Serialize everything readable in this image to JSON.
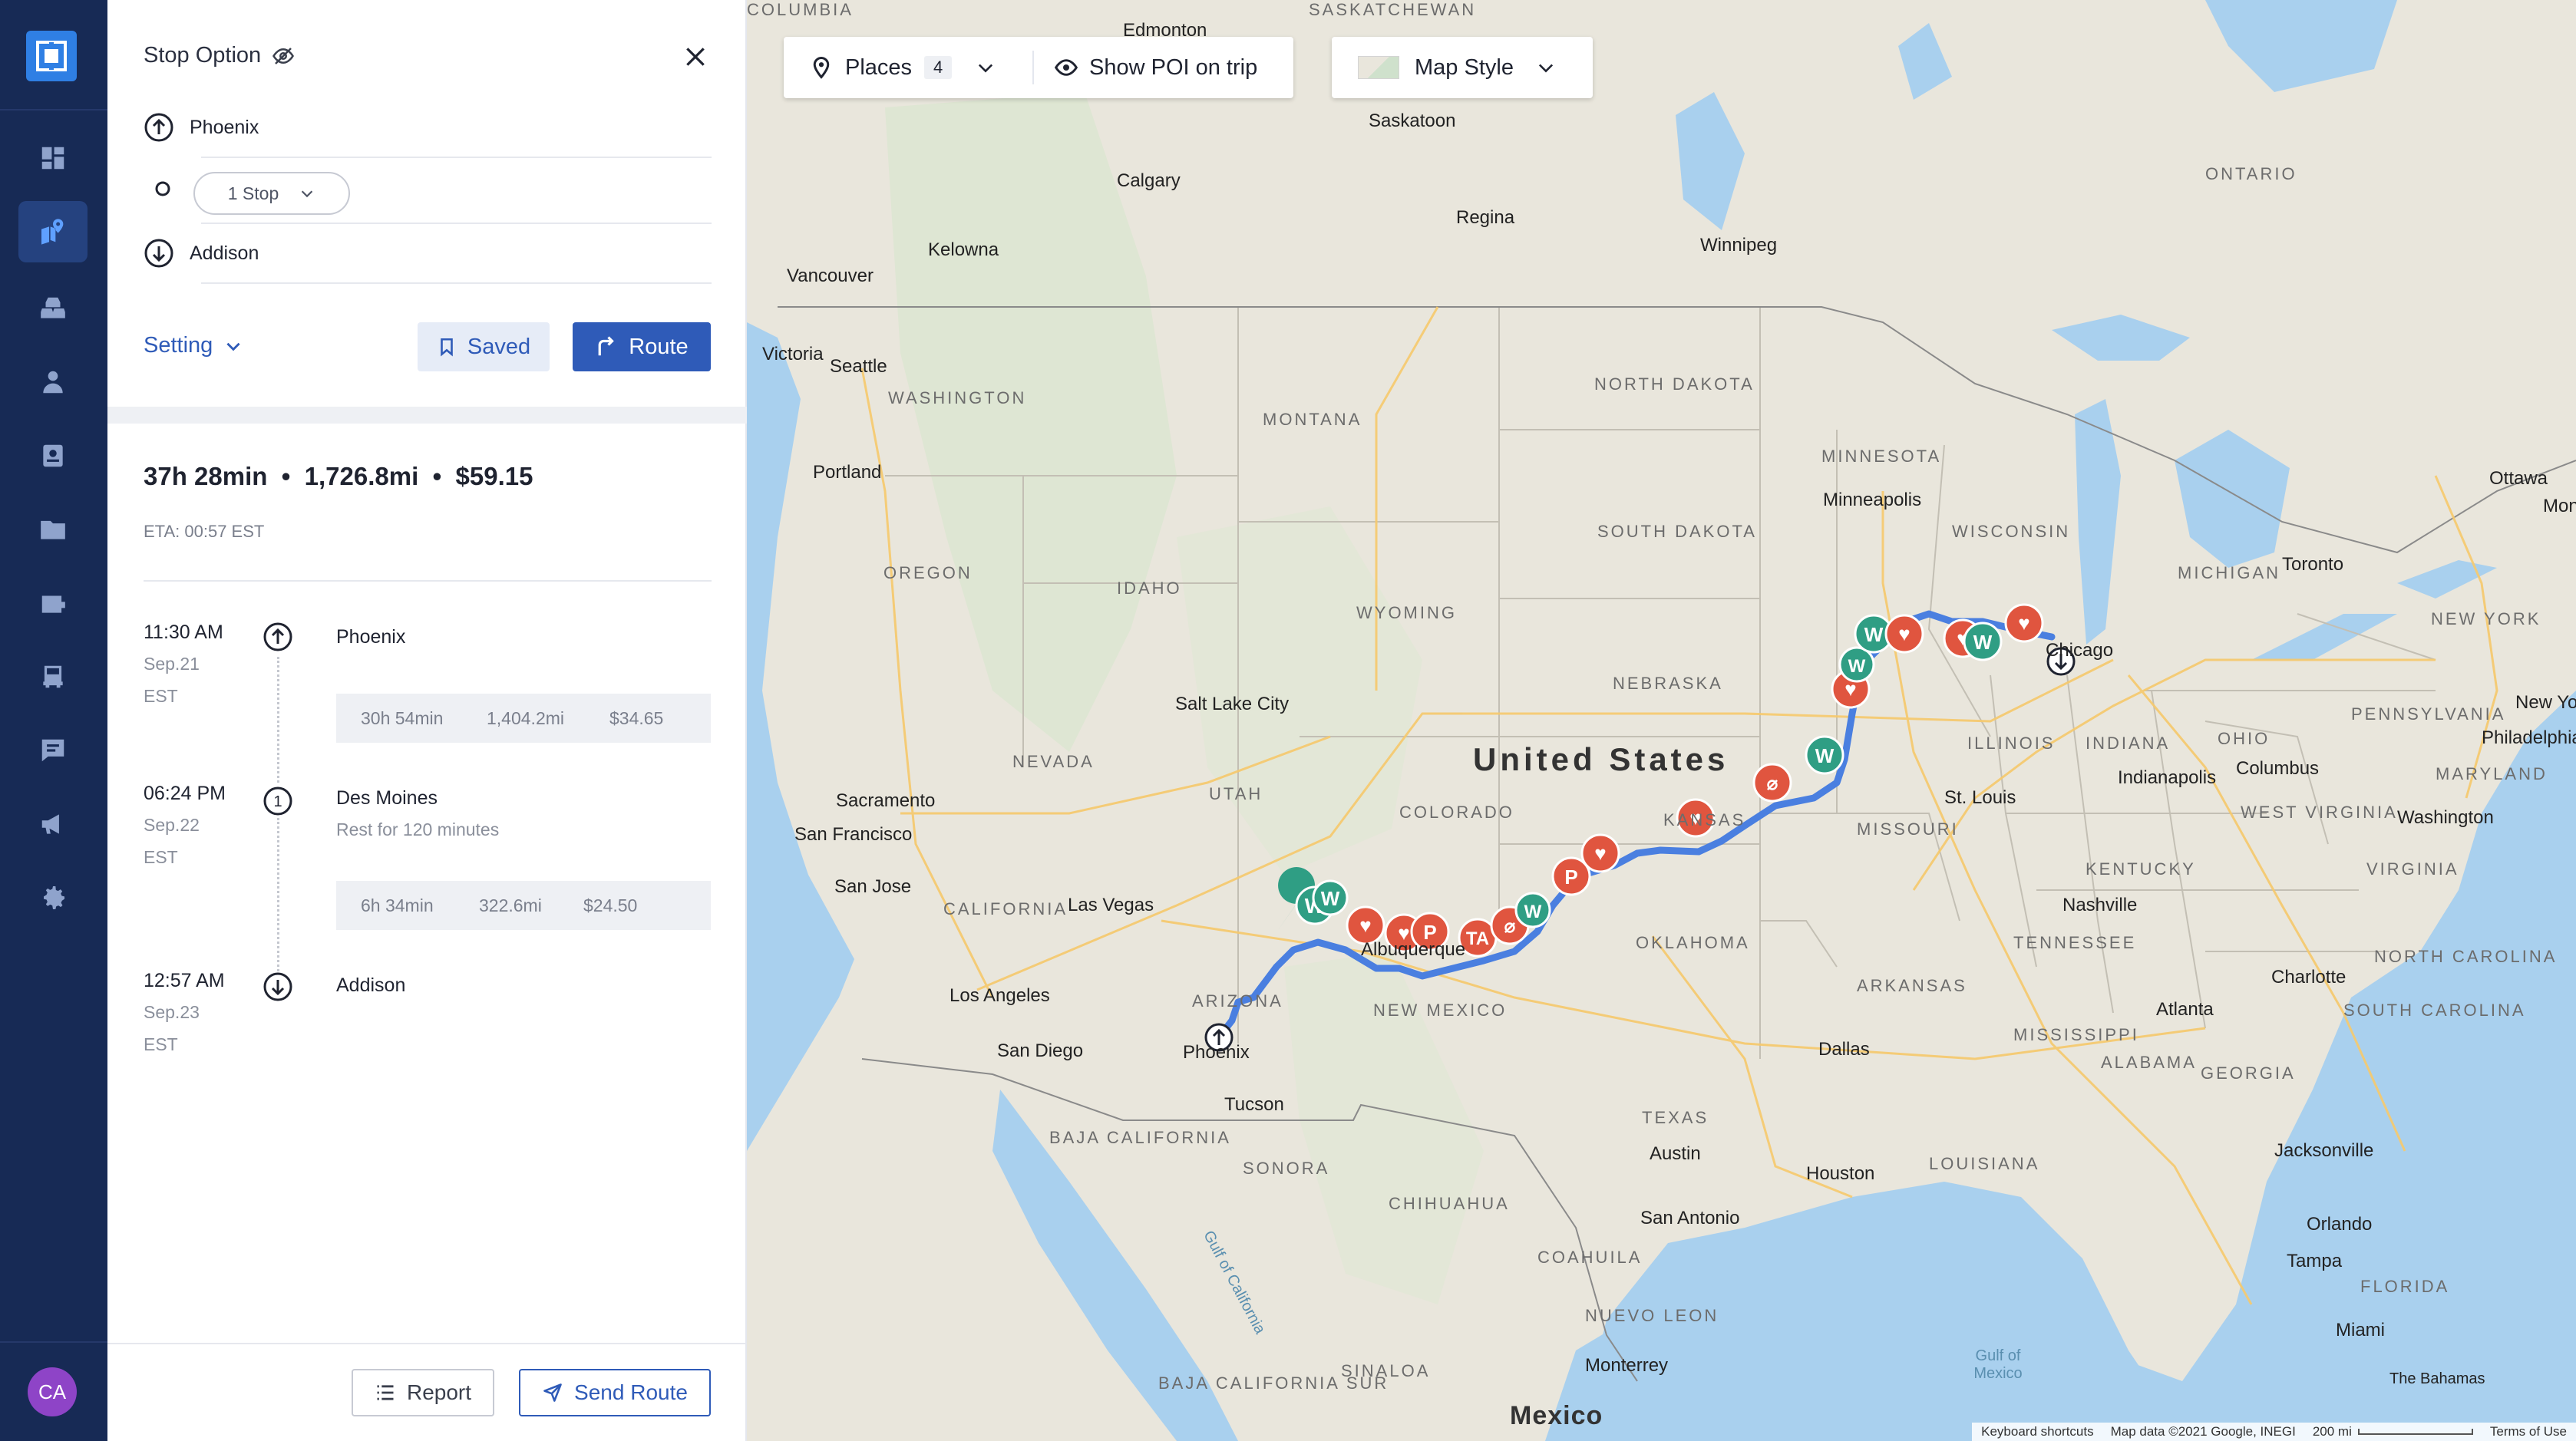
{
  "nav": {
    "items": [
      "dashboard-icon",
      "route-planner-icon",
      "fleet-icon",
      "driver-icon",
      "contacts-icon",
      "folder-icon",
      "wallet-icon",
      "truck-icon",
      "messages-icon",
      "broadcast-icon",
      "settings-icon"
    ],
    "avatar": "CA",
    "accent": "#2f7fe4",
    "bg": "#172a55"
  },
  "panel": {
    "title": "Stop Option",
    "origin": "Phoenix",
    "stops_select": "1 Stop",
    "destination": "Addison",
    "setting_label": "Setting",
    "saved_label": "Saved",
    "route_label": "Route",
    "summary": {
      "duration": "37h 28min",
      "distance": "1,726.8mi",
      "cost": "$59.15",
      "eta": "ETA: 00:57 EST"
    },
    "timeline": [
      {
        "time": "11:30 AM",
        "date": "Sep.21",
        "tz": "EST",
        "name": "Phoenix",
        "note": "",
        "leg": {
          "duration": "30h 54min",
          "distance": "1,404.2mi",
          "cost": "$34.65"
        }
      },
      {
        "time": "06:24 PM",
        "date": "Sep.22",
        "tz": "EST",
        "name": "Des Moines",
        "note": "Rest for 120 minutes",
        "leg": {
          "duration": "6h 34min",
          "distance": "322.6mi",
          "cost": "$24.50"
        }
      },
      {
        "time": "12:57 AM",
        "date": "Sep.23",
        "tz": "EST",
        "name": "Addison",
        "note": ""
      }
    ],
    "report_label": "Report",
    "send_label": "Send Route",
    "primary_color": "#2f5bb8"
  },
  "map": {
    "places_label": "Places",
    "places_count": "4",
    "poi_label": "Show POI on trip",
    "style_label": "Map Style",
    "country": "United States",
    "country2": "Mexico",
    "states": [
      "WASHINGTON",
      "OREGON",
      "CALIFORNIA",
      "NEVADA",
      "IDAHO",
      "MONTANA",
      "WYOMING",
      "UTAH",
      "ARIZONA",
      "COLORADO",
      "NEW MEXICO",
      "NORTH DAKOTA",
      "SOUTH DAKOTA",
      "NEBRASKA",
      "KANSAS",
      "OKLAHOMA",
      "TEXAS",
      "MINNESOTA",
      "WISCONSIN",
      "ILLINOIS",
      "MISSOURI",
      "ARKANSAS",
      "LOUISIANA",
      "MISSISSIPPI",
      "ALABAMA",
      "GEORGIA",
      "TENNESSEE",
      "KENTUCKY",
      "INDIANA",
      "OHIO",
      "MICHIGAN",
      "PENNSYLVANIA",
      "NEW YORK",
      "WEST VIRGINIA",
      "VIRGINIA",
      "NORTH CAROLINA",
      "SOUTH CAROLINA",
      "FLORIDA",
      "MARYLAND",
      "ONTARIO",
      "BAJA CALIFORNIA",
      "BAJA CALIFORNIA SUR",
      "SONORA",
      "CHIHUAHUA",
      "COAHUILA",
      "NUEVO LEON",
      "SINALOA",
      "SASKATCHEWAN",
      "COLUMBIA"
    ],
    "cities": [
      "Edmonton",
      "Calgary",
      "Saskatoon",
      "Regina",
      "Winnipeg",
      "Vancouver",
      "Victoria",
      "Seattle",
      "Kelowna",
      "Portland",
      "Sacramento",
      "San Francisco",
      "San Jose",
      "Las Vegas",
      "Los Angeles",
      "San Diego",
      "Phoenix",
      "Tucson",
      "Salt Lake City",
      "Minneapolis",
      "Chicago",
      "Indianapolis",
      "Columbus",
      "St. Louis",
      "Nashville",
      "Atlanta",
      "Charlotte",
      "Dallas",
      "Austin",
      "Houston",
      "San Antonio",
      "Monterrey",
      "Jacksonville",
      "Orlando",
      "Tampa",
      "Miami",
      "Toronto",
      "Ottawa",
      "Montr",
      "New York",
      "Philadelphia",
      "Washington",
      "Albuquerque",
      "The Bahamas"
    ],
    "water": [
      "Gulf of California",
      "Gulf of Mexico"
    ],
    "attribution": {
      "shortcuts": "Keyboard shortcuts",
      "data": "Map data ©2021 Google, INEGI",
      "scale": "200 mi",
      "terms": "Terms of Use"
    },
    "route_color": "#4a7fe0"
  }
}
